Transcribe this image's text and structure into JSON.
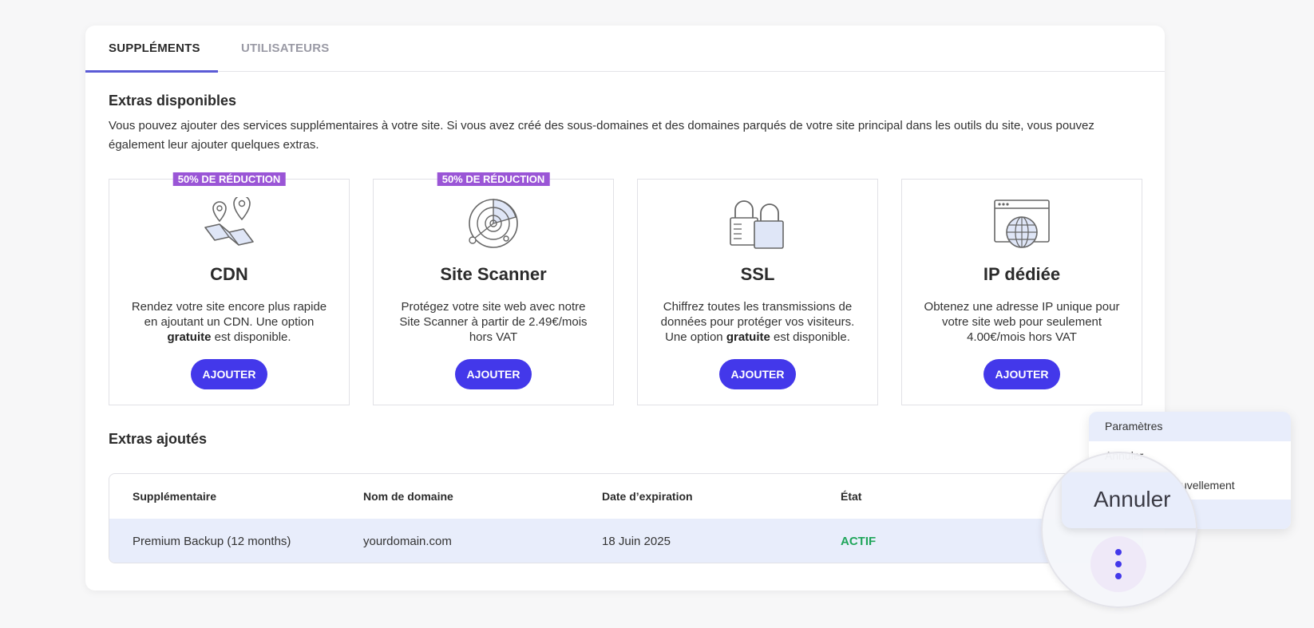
{
  "tabs": [
    {
      "label": "SUPPLÉMENTS",
      "active": true
    },
    {
      "label": "UTILISATEURS",
      "active": false
    }
  ],
  "available": {
    "title": "Extras disponibles",
    "description": "Vous pouvez ajouter des services supplémentaires à votre site. Si vous avez créé des sous-domaines et des domaines parqués de votre site principal dans les outils du site, vous pouvez également leur ajouter quelques extras."
  },
  "cards": [
    {
      "badge": "50% DE RÉDUCTION",
      "icon": "map-pins-icon",
      "title": "CDN",
      "desc_before": "Rendez votre site encore plus rapide en ajoutant un CDN. Une option ",
      "desc_bold": "gratuite",
      "desc_after": " est disponible.",
      "button": "AJOUTER"
    },
    {
      "badge": "50% DE RÉDUCTION",
      "icon": "radar-icon",
      "title": "Site Scanner",
      "desc_before": "Protégez votre site web avec notre Site Scanner à partir de 2.49€/mois hors VAT",
      "desc_bold": "",
      "desc_after": "",
      "button": "AJOUTER"
    },
    {
      "badge": "",
      "icon": "padlocks-icon",
      "title": "SSL",
      "desc_before": "Chiffrez toutes les transmissions de données pour protéger vos visiteurs. Une option ",
      "desc_bold": "gratuite",
      "desc_after": " est disponible.",
      "button": "AJOUTER"
    },
    {
      "badge": "",
      "icon": "browser-globe-icon",
      "title": "IP dédiée",
      "desc_before": "Obtenez une adresse IP unique pour votre site web pour seulement 4.00€/mois hors VAT",
      "desc_bold": "",
      "desc_after": "",
      "button": "AJOUTER"
    }
  ],
  "added": {
    "title": "Extras ajoutés",
    "columns": [
      "Supplémentaire",
      "Nom de domaine",
      "Date d’expiration",
      "État"
    ],
    "rows": [
      {
        "extra": "Premium Backup (12 months)",
        "domain": "yourdomain.com",
        "expiry": "18 Juin 2025",
        "status": "ACTIF"
      }
    ]
  },
  "menu": {
    "items": [
      "Paramètres",
      "Annuler",
      "Annuler le renouvellement",
      ""
    ],
    "magnified_label": "Annuler"
  },
  "colors": {
    "accent": "#4338ea",
    "badge": "#9a55d6",
    "active_status": "#1fa55a",
    "highlight": "#e8edfb"
  }
}
